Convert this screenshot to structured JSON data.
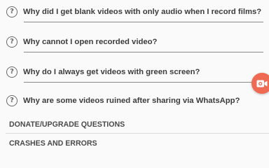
{
  "faq": {
    "items": [
      {
        "label": "Why did I get blank videos with only audio when I record films?"
      },
      {
        "label": "Why cannot I open recorded video?"
      },
      {
        "label": "Why do I always get videos with green screen?"
      },
      {
        "label": "Why are some videos ruined after sharing via WhatsApp?"
      }
    ],
    "question_glyph": "?"
  },
  "sections": [
    {
      "label": "DONATE/UPGRADE QUESTIONS"
    },
    {
      "label": "CRASHES AND ERRORS"
    }
  ],
  "floating_button": {
    "icon": "video-camera-icon",
    "color": "#ee6a52"
  }
}
